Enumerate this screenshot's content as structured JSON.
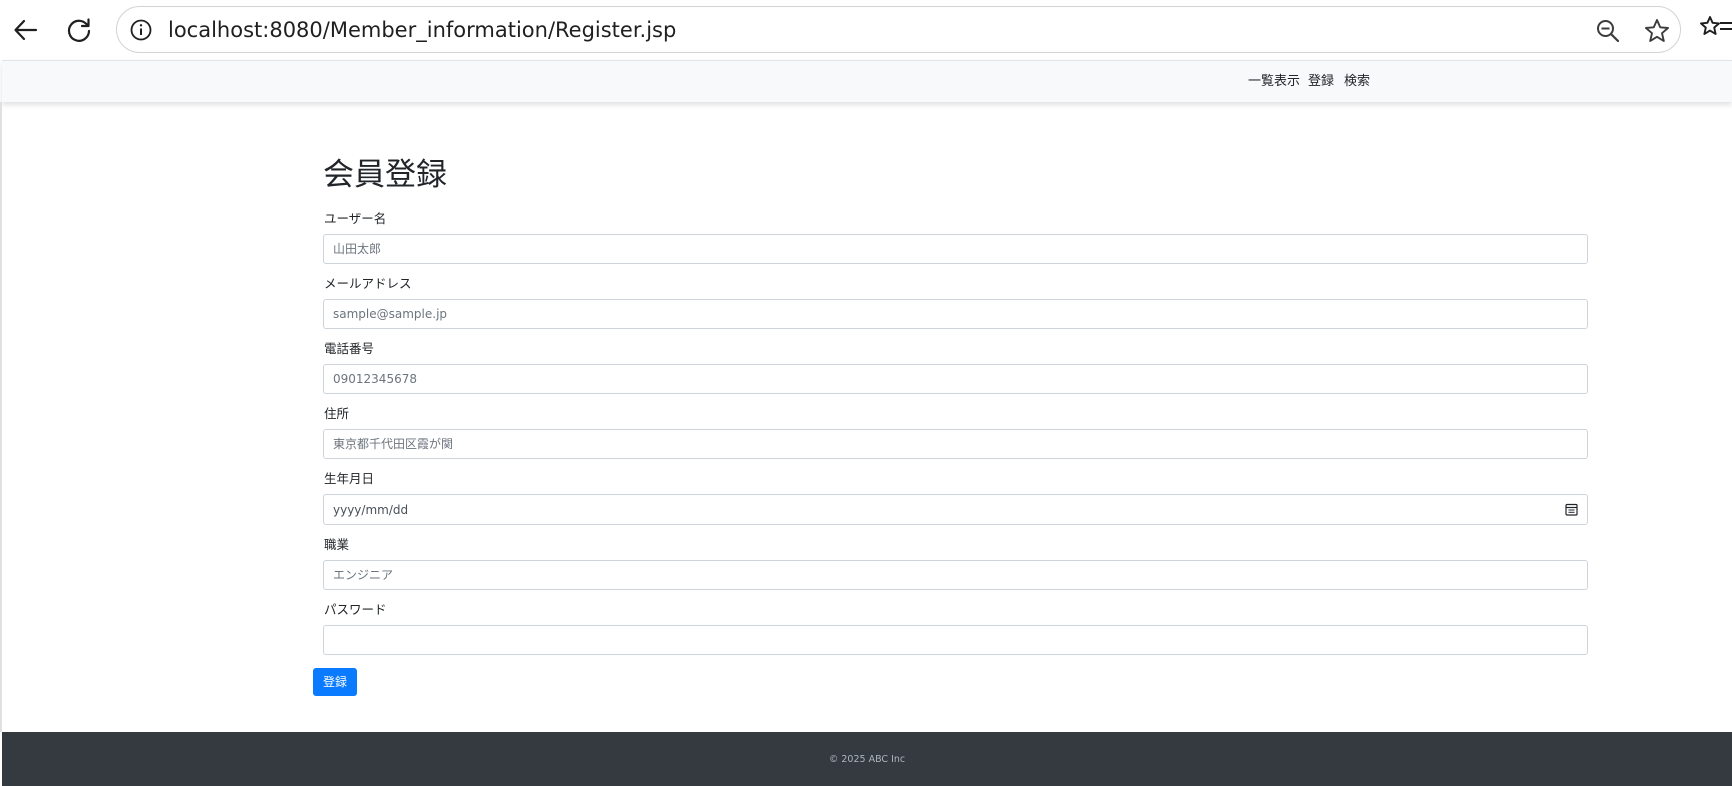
{
  "browser": {
    "url": "localhost:8080/Member_information/Register.jsp",
    "icons": [
      "back-arrow-icon",
      "reload-icon",
      "site-info-icon",
      "zoom-out-icon",
      "bookmark-star-icon",
      "reading-list-icon"
    ]
  },
  "nav": {
    "items": [
      {
        "label": "一覧表示"
      },
      {
        "label": "登録"
      },
      {
        "label": "検索"
      }
    ]
  },
  "form": {
    "title": "会員登録",
    "fields": [
      {
        "label": "ユーザー名",
        "placeholder": "山田太郎",
        "value": ""
      },
      {
        "label": "メールアドレス",
        "placeholder": "sample@sample.jp",
        "value": ""
      },
      {
        "label": "電話番号",
        "placeholder": "09012345678",
        "value": ""
      },
      {
        "label": "住所",
        "placeholder": "東京都千代田区霞が関",
        "value": ""
      },
      {
        "label": "生年月日",
        "placeholder": "yyyy/mm/dd",
        "value": ""
      },
      {
        "label": "職業",
        "placeholder": "エンジニア",
        "value": ""
      },
      {
        "label": "パスワード",
        "placeholder": "",
        "value": ""
      }
    ],
    "submit_label": "登録"
  },
  "footer": {
    "copyright": "© 2025 ABC Inc"
  },
  "colors": {
    "primary_button": "#0a7bff",
    "nav_background": "#f8f9fa",
    "footer_background": "#343a40"
  }
}
